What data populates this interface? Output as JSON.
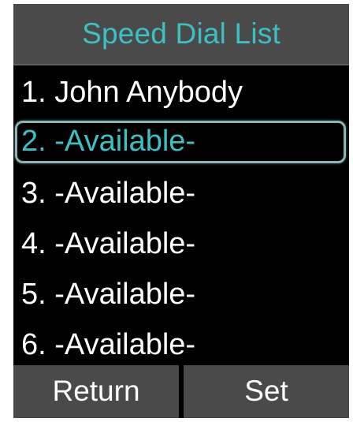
{
  "title": "Speed Dial List",
  "entries": [
    {
      "label": "1. John Anybody"
    },
    {
      "label": "2. -Available-",
      "selected": true
    },
    {
      "label": "3. -Available-"
    },
    {
      "label": "4. -Available-"
    },
    {
      "label": "5. -Available-"
    },
    {
      "label": "6. -Available-"
    }
  ],
  "softkeys": {
    "left": "Return",
    "right": "Set"
  },
  "colors": {
    "accent": "#3cc0c4",
    "bar": "#4a4a4a",
    "background": "#000000",
    "text": "#ffffff"
  }
}
